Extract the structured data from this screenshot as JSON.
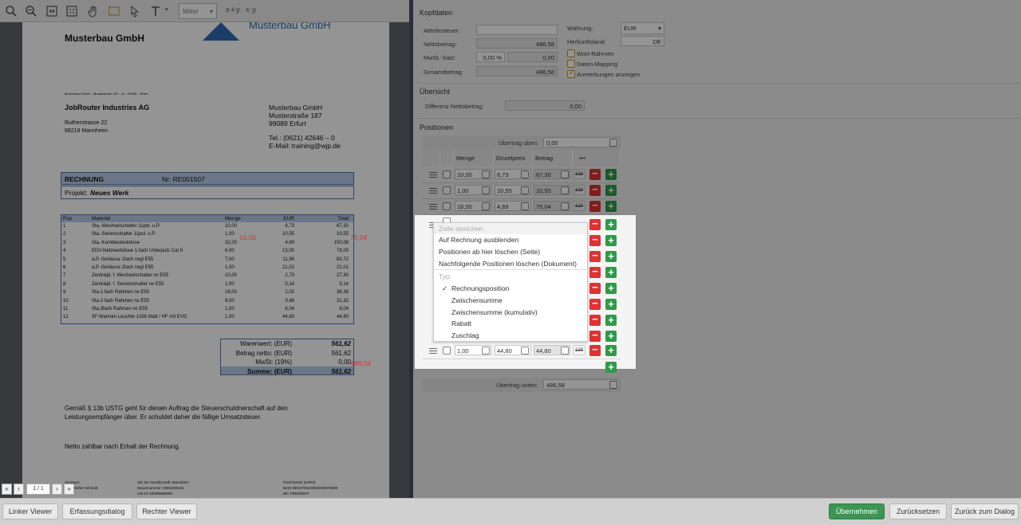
{
  "toolbar": {
    "zoom_label": "Mittel",
    "math1": "x+y",
    "math2": "x·y"
  },
  "document": {
    "company": "Musterbau GmbH",
    "logo_text": "Musterbau GmbH",
    "sender_line": "Musterbau GmbH – Musterstraße 187 – D – 99089 – Erfurt",
    "recipient": [
      "JobRouter Industries AG",
      "",
      "Rutherstrasse 22",
      "68219 Mannheim"
    ],
    "sender_address": [
      "Musterbau GmbH",
      "Musterstraße 187",
      "99089 Erfurt",
      "",
      "Tel.: (0621) 42646 – 0",
      "E-Mail: training@wjp.de"
    ],
    "invoice_label": "RECHNUNG",
    "invoice_nr": "Nr: RE001507",
    "project_label": "Projekt:",
    "project_value": "Neues Werk",
    "table_headers": [
      "Pos",
      "Material",
      "Menge",
      "EUR",
      "Total"
    ],
    "table_rows": [
      [
        "1",
        "Sta.-Wechselschalter 11pol. u.P.",
        "10,00",
        "6,73",
        "67,30"
      ],
      [
        "2",
        "Sta.-Serienschalter 11pol. u.P.",
        "1,00",
        "10,55",
        "10,55"
      ],
      [
        "3",
        "Sta.-Kombiesteckdose",
        "32,00",
        "4,69",
        "150,08"
      ],
      [
        "4",
        "EDV-Netzwerkdose 1-fach Unterputz Cat 6",
        "6,00",
        "13,00",
        "78,00"
      ],
      [
        "5",
        "a.P. Gehäuse 1fach rwgl E55",
        "7,00",
        "11,96",
        "83,72"
      ],
      [
        "6",
        "a.P. Gehäuse 2fach rwgl E55",
        "1,00",
        "21,01",
        "21,01"
      ],
      [
        "7",
        "Zentralpl. f. Wechselschalter rw E55",
        "10,00",
        "2,73",
        "27,30"
      ],
      [
        "8",
        "Zentralpl. f. Serienschalter rw E55",
        "1,00",
        "5,14",
        "5,14"
      ],
      [
        "9",
        "Sta.1-fach Rahmen rw E55",
        "18,00",
        "2,02",
        "36,36"
      ],
      [
        "10",
        "Sta.2-fach Rahmen rw E55",
        "9,00",
        "3,48",
        "31,32"
      ],
      [
        "11",
        "Sta.3fach Rahmen rw E55",
        "1,00",
        "6,04",
        "6,04"
      ],
      [
        "12",
        "3F-Wannen Leuchte 1x58 Watt / HF mit EVG",
        "1,00",
        "44,80",
        "44,80"
      ]
    ],
    "annot1": "16,00",
    "annot2": "75,04",
    "annot3": "486,58",
    "totals": [
      {
        "label": "Warenwert: (EUR)",
        "value": "561,62"
      },
      {
        "label": "Betrag netto: (EUR)",
        "value": "561,62"
      },
      {
        "label": "MwSt: (19%)",
        "value": "0,00"
      },
      {
        "label": "Summe: (EUR)",
        "value": "561,62"
      }
    ],
    "note1": "Gemäß § 13b USTG geht für diesen Auftrag die Steuerschuldnerschaft auf den",
    "note2": "Leistungsempfänger über. Er schuldet daher die fällige Umsatzsteuer.",
    "note3": "Netto zahlbar nach Erhalt der Rechnung.",
    "footer_c1": [
      "Vorstand:",
      "Prof. Stefan Schmidt"
    ],
    "footer_c2": [
      "Sitz der Gesellschaft: Mannheim",
      "Steuernummer: 93815/08152",
      "USt-Id: DE999999999"
    ],
    "footer_c3": [
      "POSTBANK (GIRO)",
      "IBAN DE02700100800030876808",
      "BIC PBNKDEFF"
    ]
  },
  "pagenav": {
    "page": "1 / 1"
  },
  "kopfdaten": {
    "title": "Kopfdaten",
    "altteilesteuer_label": "Altteilesteuer:",
    "altteilesteuer_value": "",
    "nettobetrag_label": "Nettobetrag:",
    "nettobetrag_value": "486,58",
    "mwst_label": "MwSt.-Satz:",
    "mwst_pct": "0,00 %",
    "mwst_value": "0,00",
    "gesamt_label": "Gesamtbetrag:",
    "gesamt_value": "486,58",
    "waehrung_label": "Währung:",
    "waehrung_value": "EUR",
    "herkunft_label": "Herkunftsland:",
    "herkunft_value": "DE",
    "opt1": "Wort-Rahmen",
    "opt2": "Daten-Mapping",
    "opt3": "Anmerkungen anzeigen"
  },
  "uebersicht": {
    "title": "Übersicht",
    "diff_label": "Differenz Nettobetrag:",
    "diff_value": "0,00"
  },
  "positionen": {
    "title": "Positionen",
    "uebertrag_oben_label": "Übertrag oben:",
    "uebertrag_oben_value": "0,00",
    "headers": [
      "Menge",
      "Einzelpreis",
      "Betrag",
      "•••"
    ],
    "rows": [
      {
        "menge": "10,00",
        "preis": "6,73",
        "betrag": "67,30"
      },
      {
        "menge": "1,00",
        "preis": "10,55",
        "betrag": "10,55"
      },
      {
        "menge": "16,00",
        "preis": "4,69",
        "betrag": "75,04"
      },
      {
        "menge": "1,00",
        "preis": "44,80",
        "betrag": "44,80"
      }
    ],
    "btn123": "123",
    "uebertrag_unten_label": "Übertrag unten:",
    "uebertrag_unten_value": "486,58"
  },
  "context_menu": {
    "items": [
      "Zeile streichen",
      "Auf Rechnung ausblenden",
      "Positionen ab hier löschen (Seite)",
      "Nachfolgende Positionen löschen (Dokument)"
    ],
    "typ_label": "Typ:",
    "check": "✓",
    "types": [
      "Rechnungsposition",
      "Zwischensumme",
      "Zwischensumme (kumulativ)",
      "Rabatt",
      "Zuschlag"
    ]
  },
  "bottom": {
    "left": [
      "Linker Viewer",
      "Erfassungsdialog",
      "Rechter Viewer"
    ],
    "right": [
      "Übernehmen",
      "Zurücksetzen",
      "Zurück zum Dialog"
    ]
  },
  "colors": {
    "accent_green": "#3e9553",
    "minus_red": "#dd3333",
    "annot_red": "#cc2222"
  }
}
